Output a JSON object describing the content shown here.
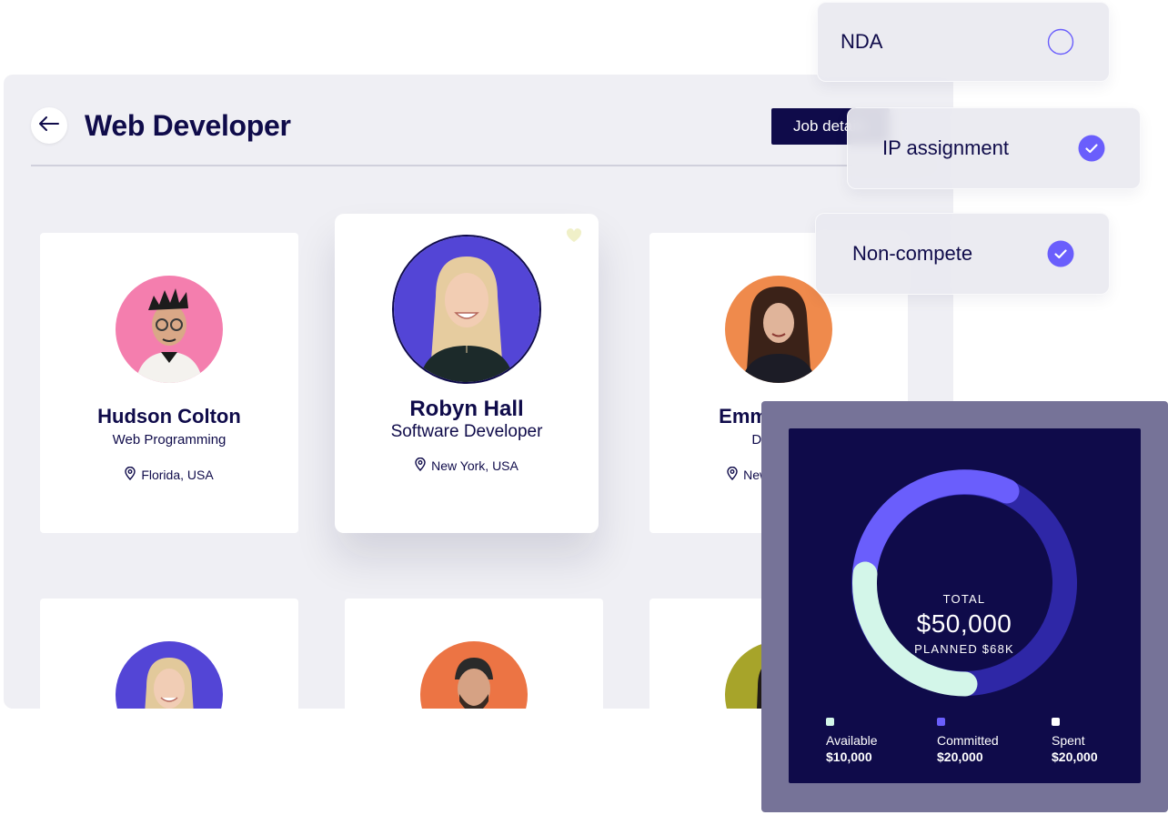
{
  "header": {
    "title": "Web Developer",
    "job_button_label": "Job details"
  },
  "candidates": [
    {
      "name": "Hudson Colton",
      "role": "Web Programming",
      "location": "Florida, USA"
    },
    {
      "name": "Robyn Hall",
      "role": "Software Developer",
      "location": "New York, USA"
    },
    {
      "name": "Emma Wyatt",
      "role": "Data Pro",
      "location": "New York, USA"
    }
  ],
  "contracts": [
    {
      "label": "NDA",
      "checked": false
    },
    {
      "label": "IP assignment",
      "checked": true
    },
    {
      "label": "Non-compete",
      "checked": true
    }
  ],
  "budget": {
    "total_label": "TOTAL",
    "total_value": "$50,000",
    "planned_label": "PLANNED $68K",
    "legend": [
      {
        "label": "Available",
        "value": "$10,000",
        "color": "#d3f6e9"
      },
      {
        "label": "Committed",
        "value": "$20,000",
        "color": "#6a5efc"
      },
      {
        "label": "Spent",
        "value": "$20,000",
        "color": "#ffffff"
      }
    ]
  },
  "colors": {
    "navy": "#0f0b4a",
    "accent": "#6a5efc",
    "mint": "#d3f6e9",
    "ring_track": "#2e27a6"
  }
}
